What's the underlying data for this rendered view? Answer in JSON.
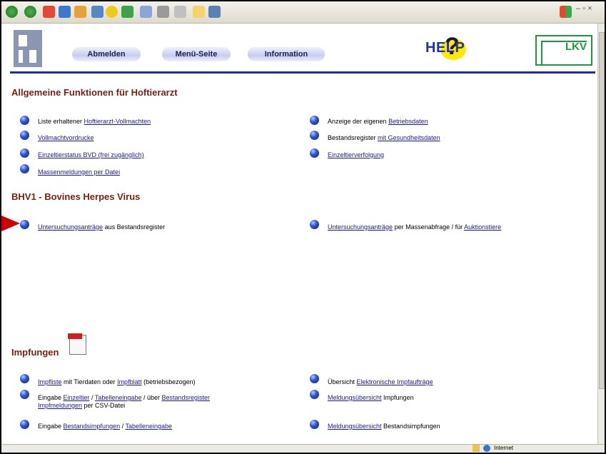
{
  "header": {
    "nav": [
      "Abmelden",
      "Menü-Seite",
      "Information"
    ],
    "help_text": "HELP",
    "help_question": "?",
    "brand": "LKV"
  },
  "sections": {
    "allgemein": {
      "title": "Allgemeine Funktionen für Hoftierarzt",
      "left": [
        {
          "pre": "Liste erhaltener ",
          "link": "Hoftierarzt-Vollmachten"
        },
        {
          "link": "Vollmachtvordrucke"
        },
        {
          "link": "Einzeltierstatus BVD (frei zugänglich)"
        },
        {
          "link": "Massenmeldungen per Datei"
        }
      ],
      "right": [
        {
          "pre": "Anzeige der eigenen ",
          "link": "Betriebsdaten"
        },
        {
          "pre": "Bestandsregister ",
          "link": "mit Gesundheitsdaten"
        },
        {
          "link": "Einzeltierverfolgung"
        }
      ]
    },
    "bhv1": {
      "title": "BHV1 - Bovines Herpes Virus",
      "left": {
        "link": "Untersuchungsanträge",
        "post": " aus Bestandsregister"
      },
      "right": {
        "link": "Untersuchungsanträge",
        "mid": " per Massenabfrage / für ",
        "link2": "Auktionstiere"
      }
    },
    "impfungen": {
      "title": "Impfungen",
      "left": {
        "row1": {
          "link": "Impfliste",
          "mid": " mit Tierdaten oder ",
          "link2": "Impfblatt",
          "post": " (betriebsbezogen)"
        },
        "row2": {
          "pre": "Eingabe ",
          "link": "Einzeltier",
          "sep1": " / ",
          "link2": "Tabelleneingabe",
          "mid": " / über ",
          "link3": "Bestandsregister",
          "link4": "Impfmeldungen",
          "post": " per CSV-Datei"
        },
        "row3": {
          "pre": "Eingabe ",
          "link": "Bestandsimpfungen",
          "sep": " / ",
          "link2": "Tabelleneingabe"
        }
      },
      "right": {
        "row1": {
          "pre": "Übersicht ",
          "link": "Elektronische Impfaufträge"
        },
        "row2": {
          "link": "Meldungsübersicht",
          "post": " Impfungen"
        },
        "row3": {
          "link": "Meldungsübersicht",
          "post": " Bestandsimpfungen"
        }
      }
    }
  },
  "status": {
    "zone": "Internet"
  }
}
